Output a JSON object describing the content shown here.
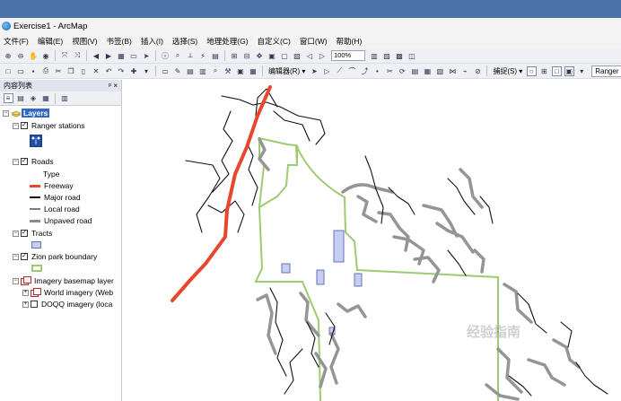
{
  "window": {
    "title": "Exercise1 - ArcMap"
  },
  "menu": [
    "文件(F)",
    "编辑(E)",
    "视图(V)",
    "书签(B)",
    "插入(I)",
    "选择(S)",
    "地理处理(G)",
    "自定义(C)",
    "窗口(W)",
    "帮助(H)"
  ],
  "toolbar": {
    "scale": "100%",
    "editor_label": "编辑器(R) ▾",
    "snapping_label": "捕捉(S) ▾",
    "ranger_tool": "Ranger sta"
  },
  "toc": {
    "title": "内容列表",
    "pin": "ᵖ ×",
    "layers_root": "Layers",
    "ranger_stations": "Ranger stations",
    "roads": "Roads",
    "roads_field": "Type",
    "road_types": [
      {
        "label": "Freeway",
        "color": "#e8472e"
      },
      {
        "label": "Major road",
        "color": "#111111"
      },
      {
        "label": "Local road",
        "color": "#7d7d7d"
      },
      {
        "label": "Unpaved road",
        "color": "#8c8c8c"
      }
    ],
    "tracts": "Tracts",
    "zion_boundary": "Zion park boundary",
    "imagery_group": "Imagery basemap layer",
    "world_imagery": "World imagery (Web",
    "doqq_imagery": "DOQQ imagery (loca"
  },
  "colors": {
    "boundary": "#9ccb72",
    "tract_fill": "#c6cff1",
    "tract_stroke": "#6473b8",
    "freeway": "#e8472e",
    "road_gray": "#959595"
  },
  "watermark": "经验指南"
}
